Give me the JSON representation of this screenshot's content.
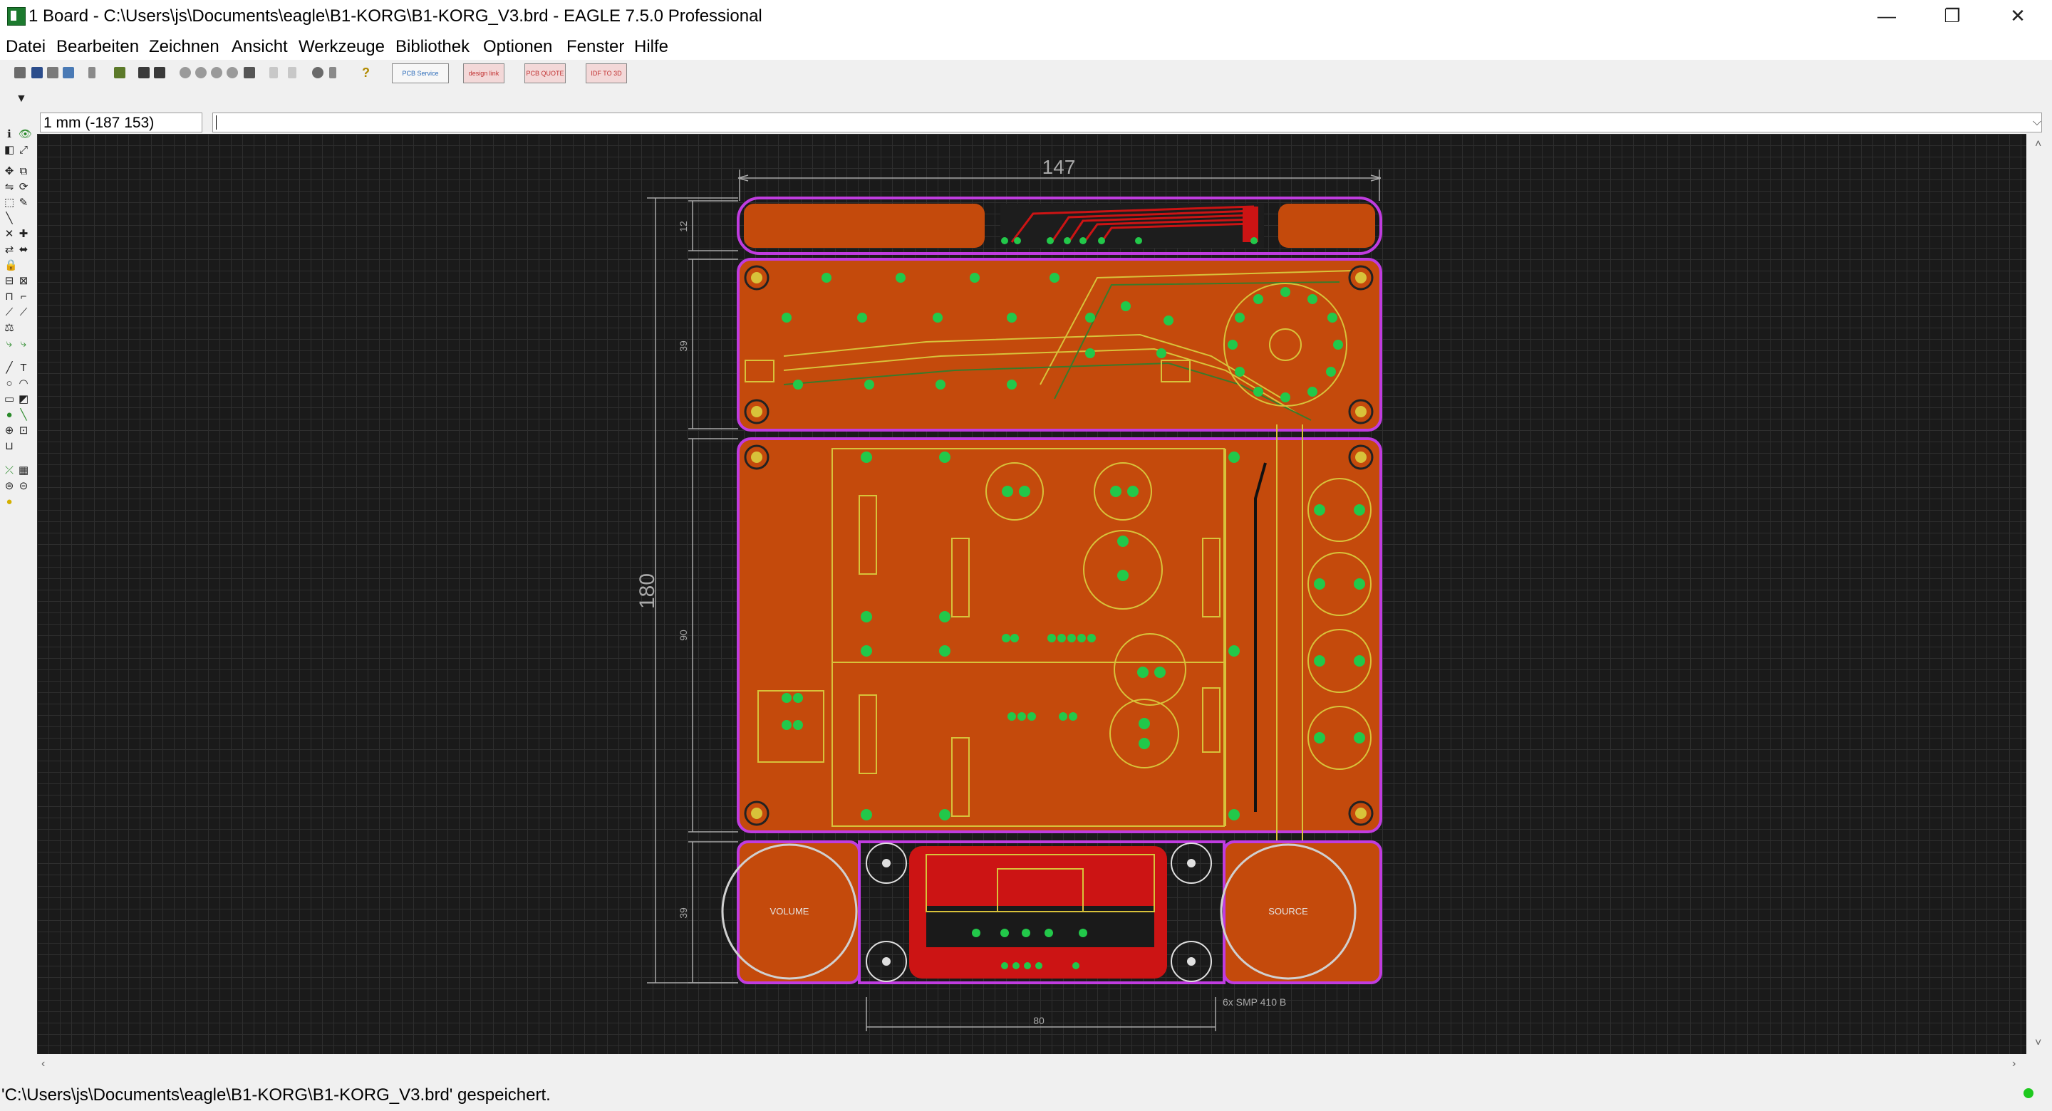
{
  "window": {
    "title": "1 Board - C:\\Users\\js\\Documents\\eagle\\B1-KORG\\B1-KORG_V3.brd - EAGLE 7.5.0 Professional",
    "minimize_glyph": "—",
    "restore_glyph": "❐",
    "close_glyph": "✕"
  },
  "menu": {
    "items": [
      "Datei",
      "Bearbeiten",
      "Zeichnen",
      "Ansicht",
      "Werkzeuge",
      "Bibliothek",
      "Optionen",
      "Fenster",
      "Hilfe"
    ]
  },
  "toolbar": {
    "help_glyph": "?",
    "badges": [
      {
        "label": "PCB Service",
        "icon": "pcb-service-icon"
      },
      {
        "label": "design link",
        "icon": "design-link-icon"
      },
      {
        "label": "PCB QUOTE",
        "icon": "pcb-quote-icon"
      },
      {
        "label": "IDF TO 3D",
        "icon": "idf-3d-icon"
      }
    ]
  },
  "command_line": {
    "coordinate": "1 mm (-187 153)",
    "value": ""
  },
  "board": {
    "dim_width": "147",
    "dim_height": "180",
    "dim_section_top": "12",
    "dim_section_upper": "39",
    "dim_section_middle": "90",
    "dim_section_lower": "39",
    "dim_bottom": "80",
    "pot_left_label": "VOLUME",
    "pot_right_label": "SOURCE",
    "note_label": "6x SMP 410 B"
  },
  "colors": {
    "board_fill": "#c44a0c",
    "board_outline": "#c03ce0",
    "pad": "#22c84a",
    "silkscreen": "#d8c23a",
    "dimension": "#a8a8a8",
    "dark_red": "#cc1414"
  },
  "status": {
    "message": "'C:\\Users\\js\\Documents\\eagle\\B1-KORG\\B1-KORG_V3.brd' gespeichert."
  }
}
